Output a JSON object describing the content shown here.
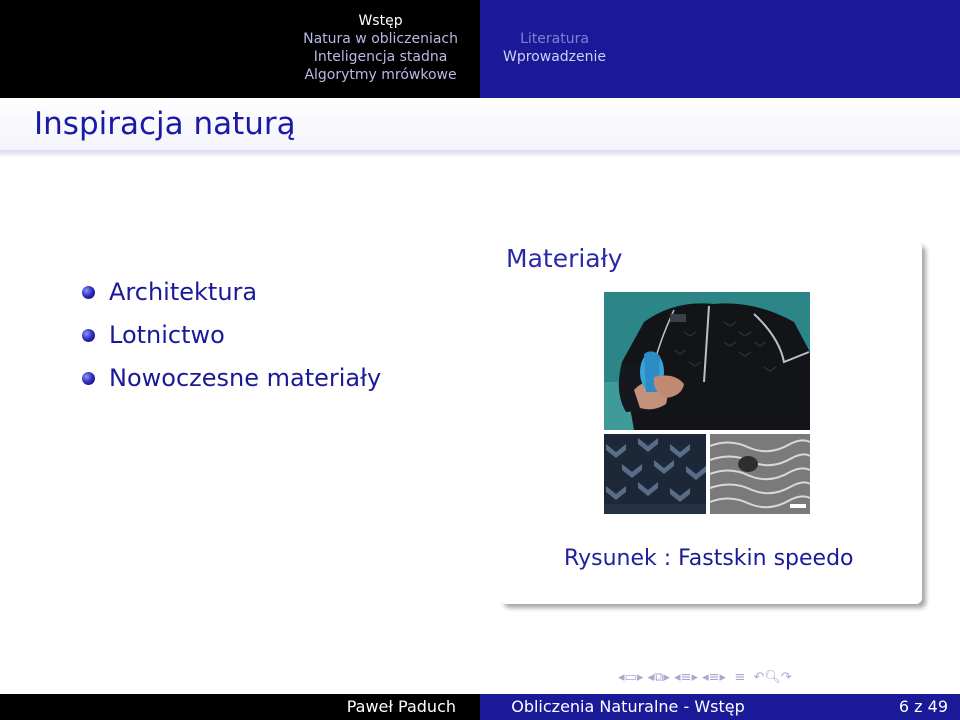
{
  "nav": {
    "left_sections": [
      "Wstęp",
      "Natura w obliczeniach",
      "Inteligencja stadna",
      "Algorytmy mrówkowe"
    ],
    "right_sections": [
      "Literatura",
      "Wprowadzenie"
    ]
  },
  "frame": {
    "title": "Inspiracja naturą"
  },
  "list": {
    "items": [
      "Architektura",
      "Lotnictwo",
      "Nowoczesne materiały"
    ]
  },
  "block": {
    "title": "Materiały",
    "figure_label": "Rysunek :",
    "figure_caption": "Fastskin speedo"
  },
  "footer": {
    "author": "Paweł Paduch",
    "title": "Obliczenia Naturalne - Wstęp",
    "page": "6 z 49"
  },
  "colors": {
    "navy": "#1a1a99",
    "black": "#000000",
    "title_blue": "#1a1aa8"
  }
}
